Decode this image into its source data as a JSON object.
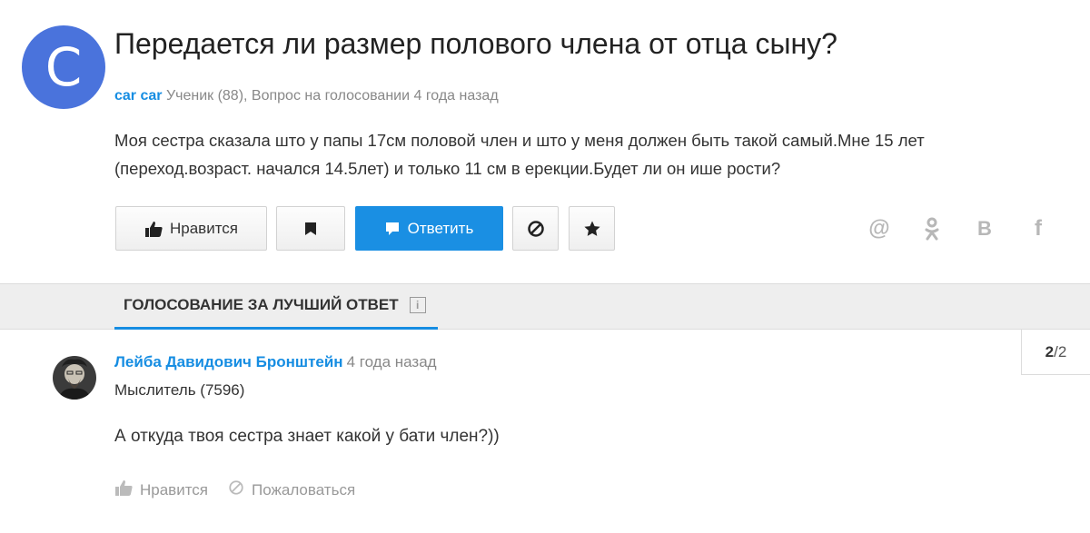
{
  "question": {
    "avatar_letter": "C",
    "avatar_color": "#4a73dc",
    "title": "Передается ли размер полового члена от отца сыну?",
    "author": "car car",
    "meta": "Ученик (88), Вопрос на голосовании 4 года назад",
    "body": "Моя сестра сказала што у папы 17см половой член и што у меня должен быть такой самый.Мне 15 лет (переход.возраст. начался 14.5лет) и только 11 см в ерекции.Будет ли он ише рости?"
  },
  "actions": {
    "like_label": "Нравится",
    "answer_label": "Ответить",
    "accent_color": "#1a8fe3"
  },
  "share": {
    "at_glyph": "@",
    "ok_glyph": "ок",
    "vk_glyph": "В",
    "fb_glyph": "f"
  },
  "voting": {
    "tab_label": "ГОЛОСОВАНИЕ ЗА ЛУЧШИЙ ОТВЕТ",
    "info_glyph": "i",
    "pager_current": "2",
    "pager_total": "/2"
  },
  "answer": {
    "author": "Лейба Давидович Бронштейн",
    "time": "4 года назад",
    "rank": "Мыслитель (7596)",
    "text": "А откуда твоя сестра знает какой у бати член?))",
    "like_label": "Нравится",
    "report_label": "Пожаловаться"
  }
}
